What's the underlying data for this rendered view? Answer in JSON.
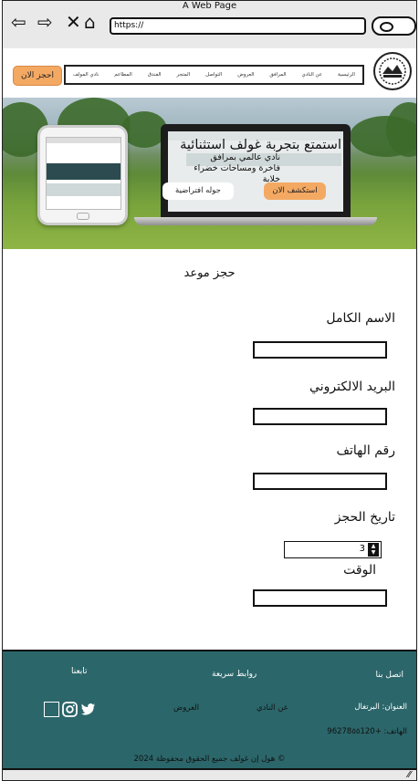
{
  "browser": {
    "title": "A Web Page",
    "url": "https://"
  },
  "header": {
    "book_button": "احجز الان",
    "nav": [
      "الرئيسية",
      "عن النادي",
      "المرافق",
      "العروض",
      "التواصل",
      "المتجر",
      "الفندق",
      "المطاعم",
      "نادي المولف"
    ]
  },
  "hero": {
    "title": "استمتع بتجربة غولف استثنائية",
    "lines": [
      "نادي عالمي بمرافق",
      "فاخرة ومساحات خضراء",
      "خلابة"
    ],
    "explore_button": "استكشف الان",
    "tour_button": "جوله افتراضية"
  },
  "form": {
    "title": "حجز موعد",
    "fields": {
      "name": "الاسم الكامل",
      "email": "البريد الالكتروني",
      "phone": "رقم الهاتف",
      "date": "تاريخ الحجز",
      "time": "الوقت"
    },
    "date_value": "3"
  },
  "footer": {
    "contact_title": "اتصل بنا",
    "links_title": "روابط سريعة",
    "follow_title": "تابعنا",
    "address": "العنوان: البرتغال",
    "phone": "الهاتف: +96278٥٥120",
    "link_about": "عن النادي",
    "link_offers": "العروض",
    "copyright": "هول إن غولف جميع الحقوق محفوظة 2024 ©"
  },
  "colors": {
    "accent_orange": "#f4a963",
    "footer_teal": "#2b666a"
  }
}
